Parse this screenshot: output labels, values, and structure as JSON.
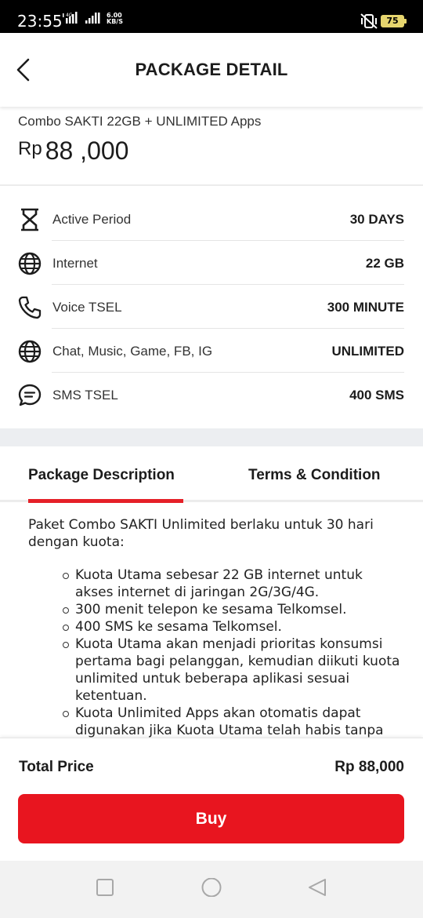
{
  "status_bar": {
    "time": "23:55",
    "network_type": "4G",
    "speed_value": "6.00",
    "speed_unit": "KB/S",
    "battery": "75"
  },
  "header": {
    "title": "PACKAGE DETAIL",
    "back_icon": "chevron-left-icon"
  },
  "package": {
    "name": "Combo SAKTI 22GB + UNLIMITED Apps",
    "currency": "Rp",
    "price": "88 ,000"
  },
  "benefits": [
    {
      "icon": "hourglass-icon",
      "label": "Active Period",
      "value": "30 DAYS"
    },
    {
      "icon": "globe-icon",
      "label": "Internet",
      "value": "22 GB"
    },
    {
      "icon": "phone-icon",
      "label": "Voice TSEL",
      "value": "300 MINUTE"
    },
    {
      "icon": "globe-icon",
      "label": "Chat, Music, Game, FB, IG",
      "value": "UNLIMITED"
    },
    {
      "icon": "chat-bubble-icon",
      "label": "SMS TSEL",
      "value": "400 SMS"
    }
  ],
  "tabs": [
    {
      "label": "Package Description",
      "active": true
    },
    {
      "label": "Terms & Condition",
      "active": false
    }
  ],
  "description": {
    "intro": "Paket Combo SAKTI Unlimited berlaku untuk 30 hari dengan kuota:",
    "items": [
      "Kuota Utama sebesar 22 GB internet untuk akses internet di jaringan 2G/3G/4G.",
      "300 menit telepon ke sesama Telkomsel.",
      "400 SMS ke sesama Telkomsel.",
      "Kuota Utama akan menjadi prioritas konsumsi pertama bagi pelanggan, kemudian diikuti kuota unlimited untuk beberapa aplikasi sesuai ketentuan.",
      "Kuota Unlimited Apps akan otomatis dapat digunakan jika Kuota Utama telah habis tanpa ada"
    ]
  },
  "total": {
    "label": "Total Price",
    "value": "Rp 88,000"
  },
  "buy_button": "Buy",
  "colors": {
    "accent": "#e8151f",
    "tab_underline": "#e52028",
    "band": "#eceef1"
  }
}
